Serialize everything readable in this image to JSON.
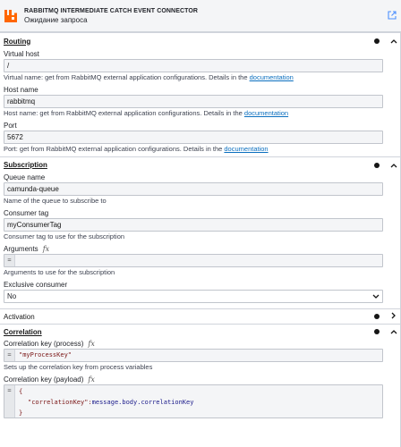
{
  "header": {
    "title": "RABBITMQ INTERMEDIATE CATCH EVENT CONNECTOR",
    "subtitle": "Ожидание запроса",
    "logo_icon": "rabbitmq-logo-icon",
    "link_icon": "external-link-icon"
  },
  "groups": {
    "routing": {
      "title": "Routing",
      "virtual_host": {
        "label": "Virtual host",
        "value": "/",
        "desc": "Virtual name: get from RabbitMQ external application configurations. Details in the",
        "link": "documentation"
      },
      "host_name": {
        "label": "Host name",
        "value": "rabbitmq",
        "desc": "Host name: get from RabbitMQ external application configurations. Details in the",
        "link": "documentation"
      },
      "port": {
        "label": "Port",
        "value": "5672",
        "desc": "Port: get from RabbitMQ external application configurations. Details in the",
        "link": "documentation"
      }
    },
    "subscription": {
      "title": "Subscription",
      "queue_name": {
        "label": "Queue name",
        "value": "camunda-queue",
        "desc": "Name of the queue to subscribe to"
      },
      "consumer_tag": {
        "label": "Consumer tag",
        "value": "myConsumerTag",
        "desc": "Consumer tag to use for the subscription"
      },
      "arguments": {
        "label": "Arguments",
        "fx": "fx",
        "eq": "=",
        "value": "",
        "desc": "Arguments to use for the subscription"
      },
      "exclusive": {
        "label": "Exclusive consumer",
        "value": "No"
      }
    },
    "activation": {
      "title": "Activation"
    },
    "correlation": {
      "title": "Correlation",
      "key_process": {
        "label": "Correlation key (process)",
        "fx": "fx",
        "eq": "=",
        "value": "\"myProcessKey\"",
        "desc": "Sets up the correlation key from process variables"
      },
      "key_payload": {
        "label": "Correlation key (payload)",
        "fx": "fx",
        "eq": "=",
        "line1": "{",
        "key": "\"correlationKey\"",
        "sep": ":",
        "expr": "message.body.correlationKey",
        "line3": "}"
      }
    }
  },
  "colors": {
    "accent": "#4d90ff",
    "link": "#0b6fbf",
    "logo": "#ff6600"
  }
}
